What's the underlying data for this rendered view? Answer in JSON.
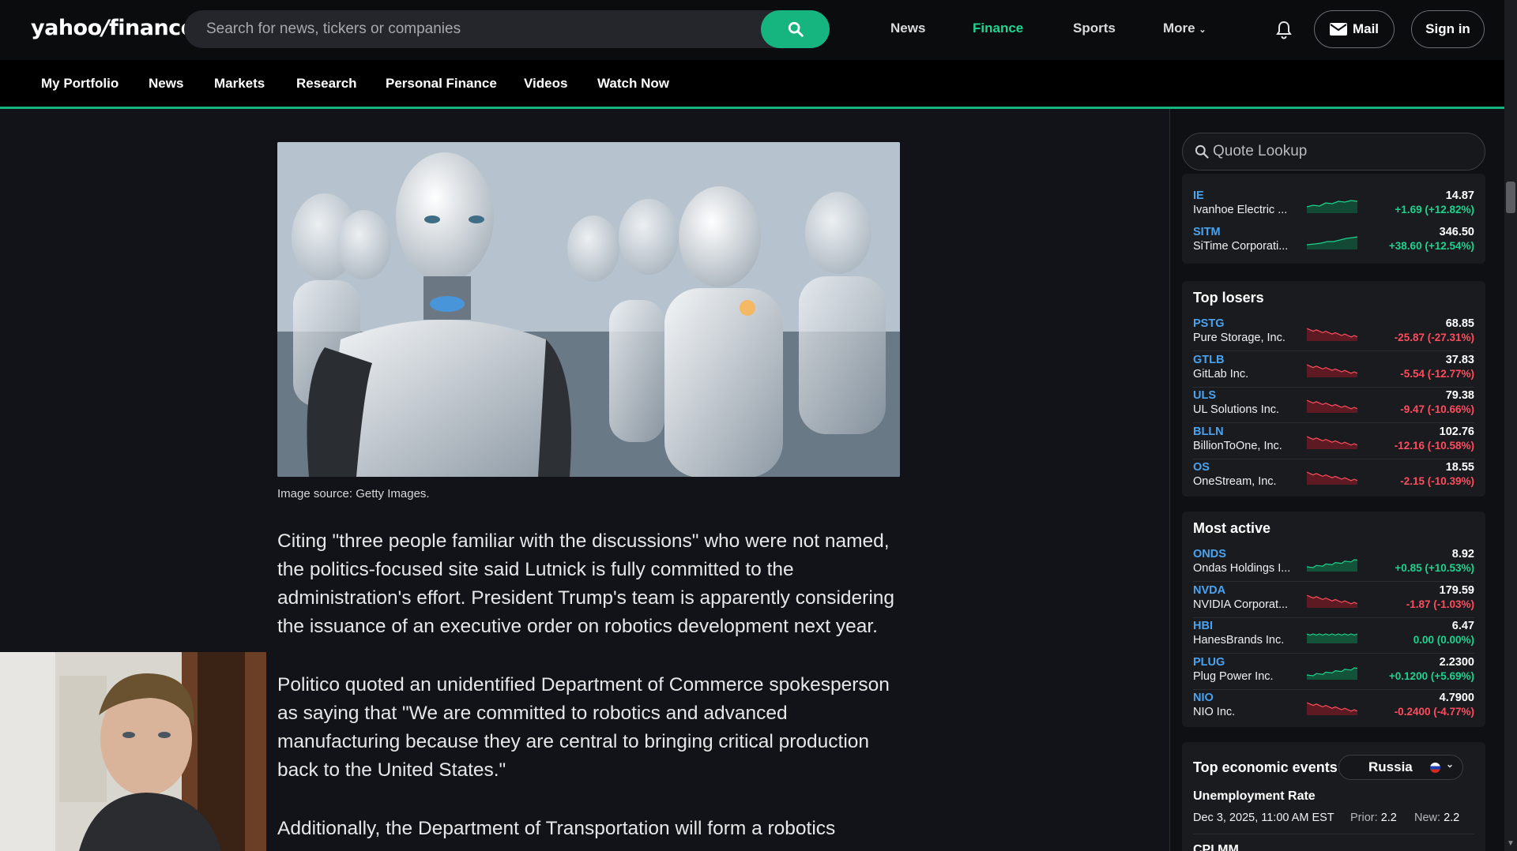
{
  "header": {
    "logo": "yahoo/finance",
    "logo_main": "yahoo",
    "logo_slash": "/",
    "logo_tail": "finance",
    "search_placeholder": "Search for news, tickers or companies",
    "nav": [
      "News",
      "Finance",
      "Sports",
      "More"
    ],
    "mail_label": "Mail",
    "signin_label": "Sign in"
  },
  "subnav": [
    "My Portfolio",
    "News",
    "Markets",
    "Research",
    "Personal Finance",
    "Videos",
    "Watch Now"
  ],
  "article": {
    "image_caption": "Image source: Getty Images.",
    "paragraphs": [
      "Citing \"three people familiar with the discussions\" who were not named, the politics-focused site said Lutnick is fully committed to the administration's effort. President Trump's team is apparently considering the issuance of an executive order on robotics development next year.",
      "Politico quoted an unidentified Department of Commerce spokesperson as saying that \"We are committed to robotics and advanced manufacturing because they are central to bringing critical production back to the United States.\"",
      "Additionally, the Department of Transportation will form a robotics"
    ]
  },
  "rail": {
    "quote_placeholder": "Quote Lookup",
    "top_gainers_partial": [
      {
        "symbol": "IE",
        "name": "Ivanhoe Electric ...",
        "price": "14.87",
        "change": "+1.69 (+12.82%)",
        "dir": "up"
      },
      {
        "symbol": "SITM",
        "name": "SiTime Corporati...",
        "price": "346.50",
        "change": "+38.60 (+12.54%)",
        "dir": "up"
      }
    ],
    "top_losers_title": "Top losers",
    "top_losers": [
      {
        "symbol": "PSTG",
        "name": "Pure Storage, Inc.",
        "price": "68.85",
        "change": "-25.87 (-27.31%)",
        "dir": "dn"
      },
      {
        "symbol": "GTLB",
        "name": "GitLab Inc.",
        "price": "37.83",
        "change": "-5.54 (-12.77%)",
        "dir": "dn"
      },
      {
        "symbol": "ULS",
        "name": "UL Solutions Inc.",
        "price": "79.38",
        "change": "-9.47 (-10.66%)",
        "dir": "dn"
      },
      {
        "symbol": "BLLN",
        "name": "BillionToOne, Inc.",
        "price": "102.76",
        "change": "-12.16 (-10.58%)",
        "dir": "dn"
      },
      {
        "symbol": "OS",
        "name": "OneStream, Inc.",
        "price": "18.55",
        "change": "-2.15 (-10.39%)",
        "dir": "dn"
      }
    ],
    "most_active_title": "Most active",
    "most_active": [
      {
        "symbol": "ONDS",
        "name": "Ondas Holdings I...",
        "price": "8.92",
        "change": "+0.85 (+10.53%)",
        "dir": "up"
      },
      {
        "symbol": "NVDA",
        "name": "NVIDIA Corporat...",
        "price": "179.59",
        "change": "-1.87 (-1.03%)",
        "dir": "dn"
      },
      {
        "symbol": "HBI",
        "name": "HanesBrands Inc.",
        "price": "6.47",
        "change": "0.00 (0.00%)",
        "dir": "flat"
      },
      {
        "symbol": "PLUG",
        "name": "Plug Power Inc.",
        "price": "2.2300",
        "change": "+0.1200 (+5.69%)",
        "dir": "up"
      },
      {
        "symbol": "NIO",
        "name": "NIO Inc.",
        "price": "4.7900",
        "change": "-0.2400 (-4.77%)",
        "dir": "dn"
      }
    ],
    "econ_title": "Top economic events",
    "econ_country": "Russia",
    "econ_events": [
      {
        "name": "Unemployment Rate",
        "date": "Dec 3, 2025, 11:00 AM EST",
        "prior_label": "Prior:",
        "prior": "2.2",
        "new_label": "New:",
        "new": "2.2"
      },
      {
        "name": "CPI MM"
      }
    ]
  },
  "colors": {
    "accent": "#16b47e",
    "up": "#1ed28e",
    "down": "#ff4d5e",
    "link": "#4aa3f0"
  }
}
